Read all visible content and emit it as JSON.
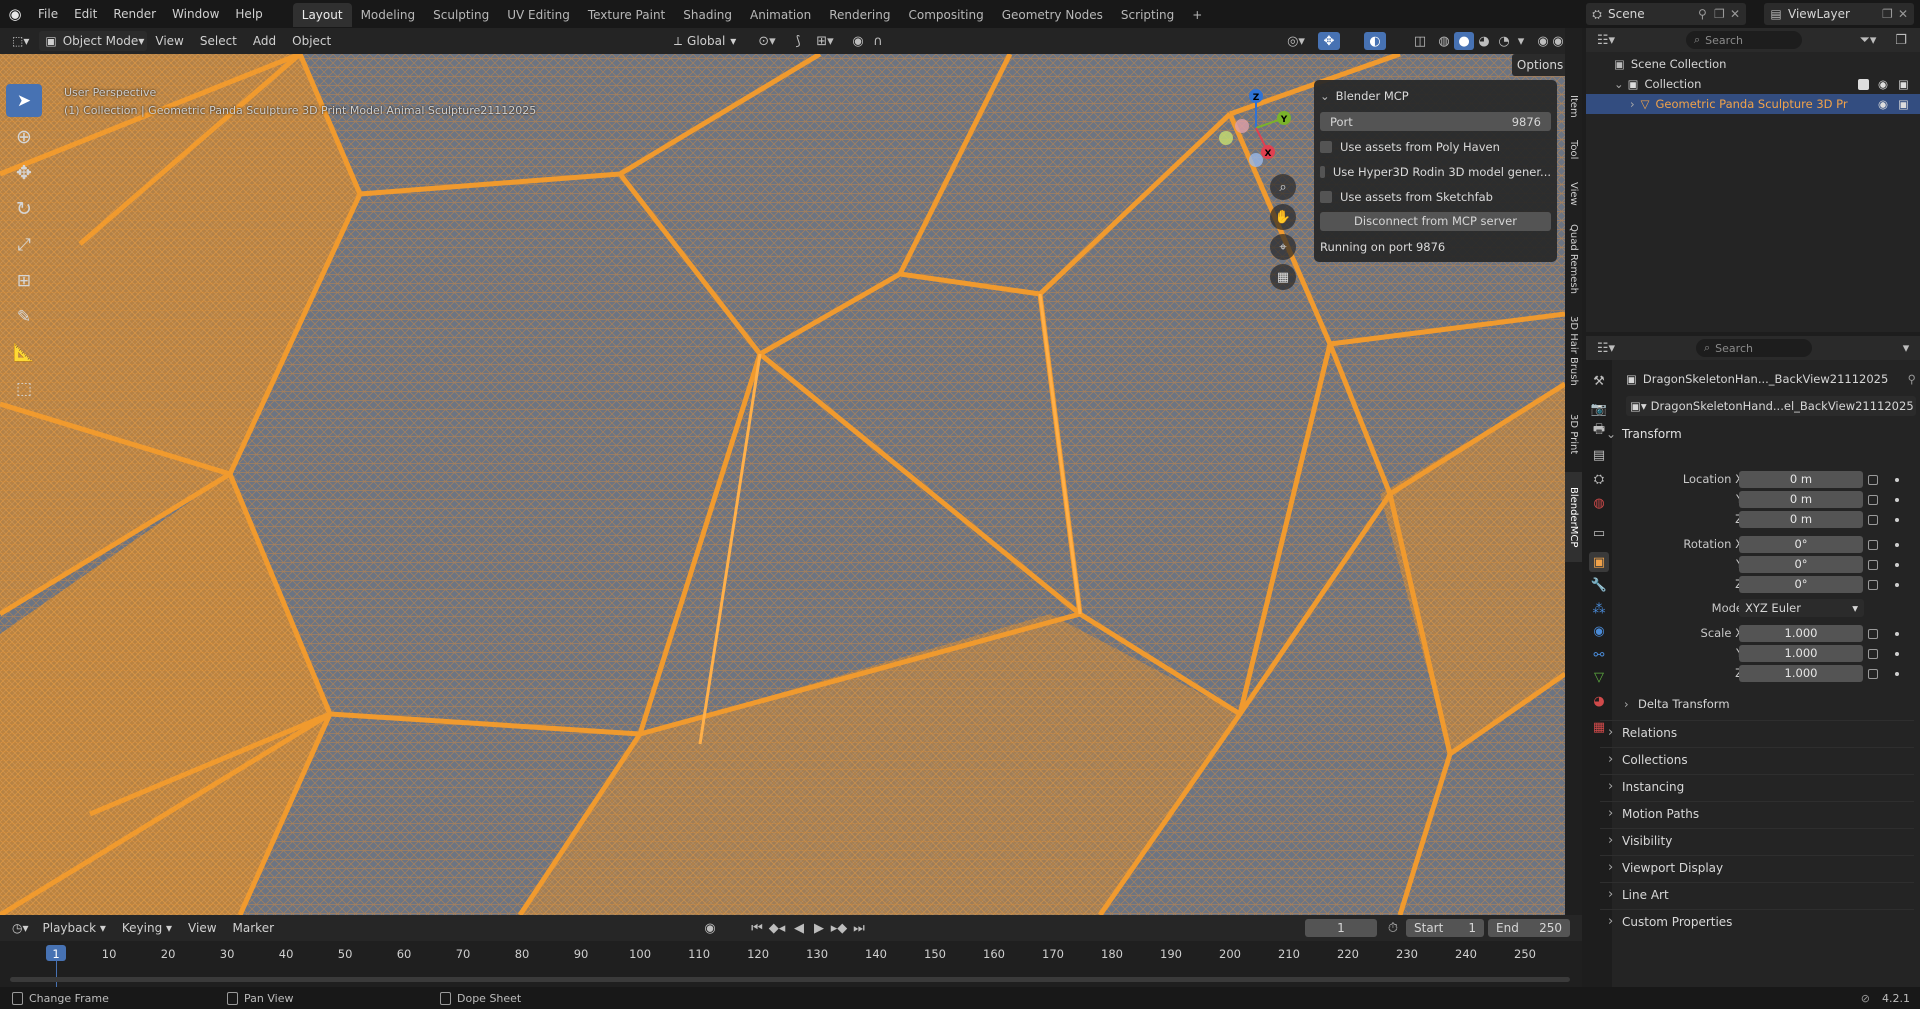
{
  "topbar": {
    "menus": [
      "File",
      "Edit",
      "Render",
      "Window",
      "Help"
    ],
    "workspaces": [
      "Layout",
      "Modeling",
      "Sculpting",
      "UV Editing",
      "Texture Paint",
      "Shading",
      "Animation",
      "Rendering",
      "Compositing",
      "Geometry Nodes",
      "Scripting"
    ],
    "active_workspace": "Layout",
    "add_tab": "+",
    "scene_label": "Scene",
    "viewlayer_label": "ViewLayer"
  },
  "viewport_header": {
    "mode": "Object Mode",
    "menus": [
      "View",
      "Select",
      "Add",
      "Object"
    ],
    "transform_orientation": "Global",
    "options_label": "Options"
  },
  "viewport": {
    "perspective_label": "User Perspective",
    "object_info": "(1) Collection | Geometric Panda Sculpture 3D Print Model Animal Sculpture21112025",
    "accent_color": "#f09a2e",
    "background_color": "#6c7482",
    "gizmo_axes": [
      "X",
      "Y",
      "Z"
    ]
  },
  "mcp_panel": {
    "title": "Blender MCP",
    "port_label": "Port",
    "port_value": "9876",
    "options": [
      "Use assets from Poly Haven",
      "Use Hyper3D Rodin 3D model gener...",
      "Use assets from Sketchfab"
    ],
    "disconnect_label": "Disconnect from MCP server",
    "status": "Running on port 9876"
  },
  "sidebar_tabs": [
    "Item",
    "Tool",
    "View",
    "Quad Remesh",
    "3D Hair Brush",
    "3D Print",
    "BlenderMCP"
  ],
  "outliner": {
    "search_placeholder": "Search",
    "scene_collection": "Scene Collection",
    "collection": "Collection",
    "object": "Geometric Panda Sculpture 3D Pr"
  },
  "properties": {
    "search_placeholder": "Search",
    "object_name": "DragonSkeletonHan..._BackView21112025",
    "data_name": "DragonSkeletonHand...el_BackView21112025",
    "transform_title": "Transform",
    "location_x_label": "Location X",
    "rotation_x_label": "Rotation X",
    "scale_x_label": "Scale X",
    "y_label": "Y",
    "z_label": "Z",
    "location": [
      "0 m",
      "0 m",
      "0 m"
    ],
    "rotation": [
      "0°",
      "0°",
      "0°"
    ],
    "mode_label": "Mode",
    "mode_value": "XYZ Euler",
    "scale": [
      "1.000",
      "1.000",
      "1.000"
    ],
    "delta_transform": "Delta Transform",
    "panels": [
      "Relations",
      "Collections",
      "Instancing",
      "Motion Paths",
      "Visibility",
      "Viewport Display",
      "Line Art",
      "Custom Properties"
    ]
  },
  "timeline": {
    "menus": [
      "Playback",
      "Keying",
      "View",
      "Marker"
    ],
    "current_frame": "1",
    "start_label": "Start",
    "start_value": "1",
    "end_label": "End",
    "end_value": "250",
    "ticks": [
      "1",
      "10",
      "20",
      "30",
      "40",
      "50",
      "60",
      "70",
      "80",
      "90",
      "100",
      "110",
      "120",
      "130",
      "140",
      "150",
      "160",
      "170",
      "180",
      "190",
      "200",
      "210",
      "220",
      "230",
      "240",
      "250"
    ]
  },
  "statusbar": {
    "hints": [
      "Change Frame",
      "Pan View",
      "Dope Sheet"
    ],
    "version": "4.2.1"
  }
}
